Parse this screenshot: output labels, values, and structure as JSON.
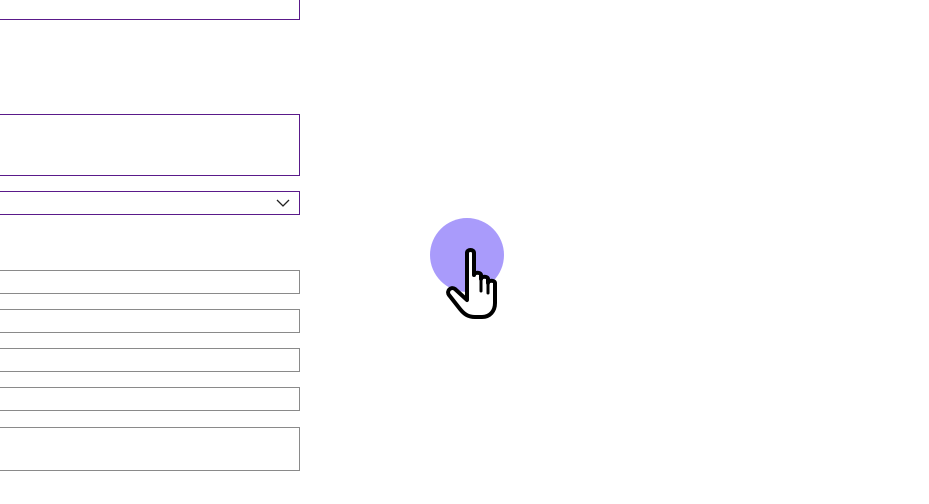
{
  "form": {
    "fields": [
      {
        "type": "input",
        "state": "focused-accent",
        "value": ""
      },
      {
        "type": "textarea",
        "state": "focused-accent",
        "value": ""
      },
      {
        "type": "select",
        "state": "accent",
        "value": ""
      },
      {
        "type": "input",
        "state": "default",
        "value": ""
      },
      {
        "type": "input",
        "state": "default",
        "value": ""
      },
      {
        "type": "input",
        "state": "default",
        "value": ""
      },
      {
        "type": "input",
        "state": "default",
        "value": ""
      },
      {
        "type": "textarea",
        "state": "default",
        "value": ""
      }
    ]
  },
  "colors": {
    "accent_border": "#5a1a8a",
    "default_border": "#8a8a8a",
    "cursor_highlight": "#a99bfb"
  },
  "cursor": {
    "icon": "hand-pointer-icon"
  }
}
